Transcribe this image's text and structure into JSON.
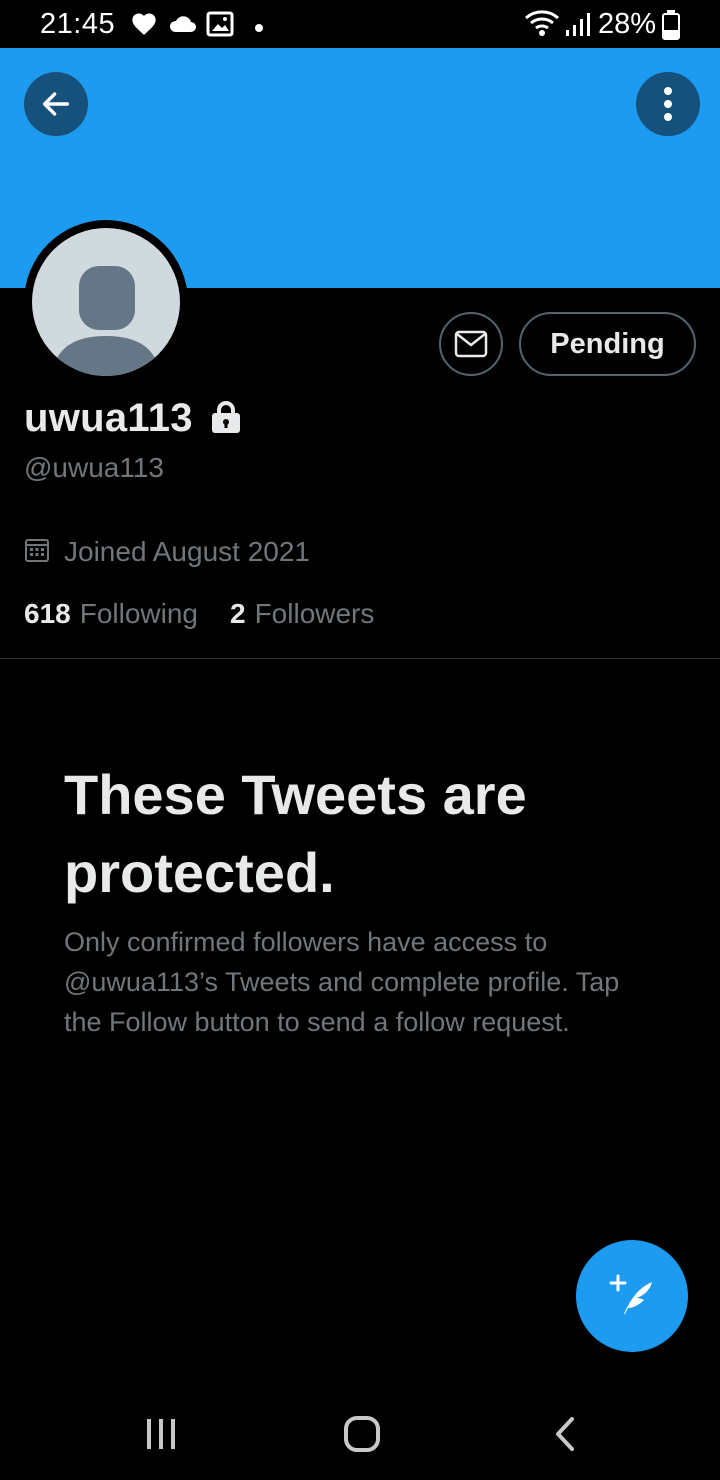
{
  "status_bar": {
    "time": "21:45",
    "battery_percent": "28%",
    "icons": [
      "heart-icon",
      "cloud-icon",
      "image-icon",
      "dot-icon",
      "wifi-icon",
      "signal-icon",
      "battery-icon"
    ]
  },
  "banner": {
    "color": "#1d9bf0"
  },
  "profile": {
    "display_name": "uwua113",
    "handle": "@uwua113",
    "protected": true,
    "joined": "Joined August 2021",
    "following_count": "618",
    "following_label": "Following",
    "followers_count": "2",
    "followers_label": "Followers"
  },
  "actions": {
    "pending_label": "Pending"
  },
  "protected_notice": {
    "title": "These Tweets are protected.",
    "body": "Only confirmed followers have access to @uwua113’s Tweets and complete profile. Tap the Follow button to send a follow request."
  },
  "colors": {
    "accent": "#1d9bf0",
    "background": "#000000",
    "primary_text": "#e7e9ea",
    "secondary_text": "#71767b",
    "border": "#536471"
  }
}
